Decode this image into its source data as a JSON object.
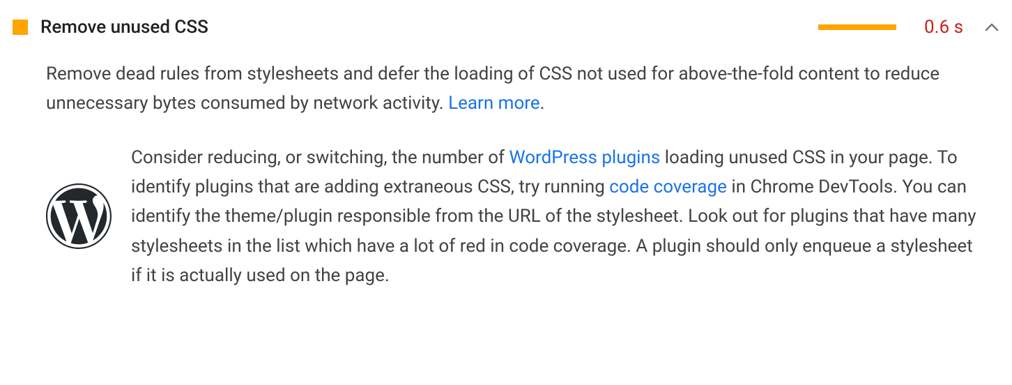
{
  "audit": {
    "title": "Remove unused CSS",
    "savings": "0.6 s",
    "description_pre": "Remove dead rules from stylesheets and defer the loading of CSS not used for above-the-fold content to reduce unnecessary bytes consumed by network activity. ",
    "learn_more": "Learn more",
    "description_post": "."
  },
  "wordpress": {
    "text_1": "Consider reducing, or switching, the number of ",
    "link_1": "WordPress plugins",
    "text_2": " loading unused CSS in your page. To identify plugins that are adding extraneous CSS, try running ",
    "link_2": "code coverage",
    "text_3": " in Chrome DevTools. You can identify the theme/plugin responsible from the URL of the stylesheet. Look out for plugins that have many stylesheets in the list which have a lot of red in code coverage. A plugin should only enqueue a stylesheet if it is actually used on the page."
  }
}
